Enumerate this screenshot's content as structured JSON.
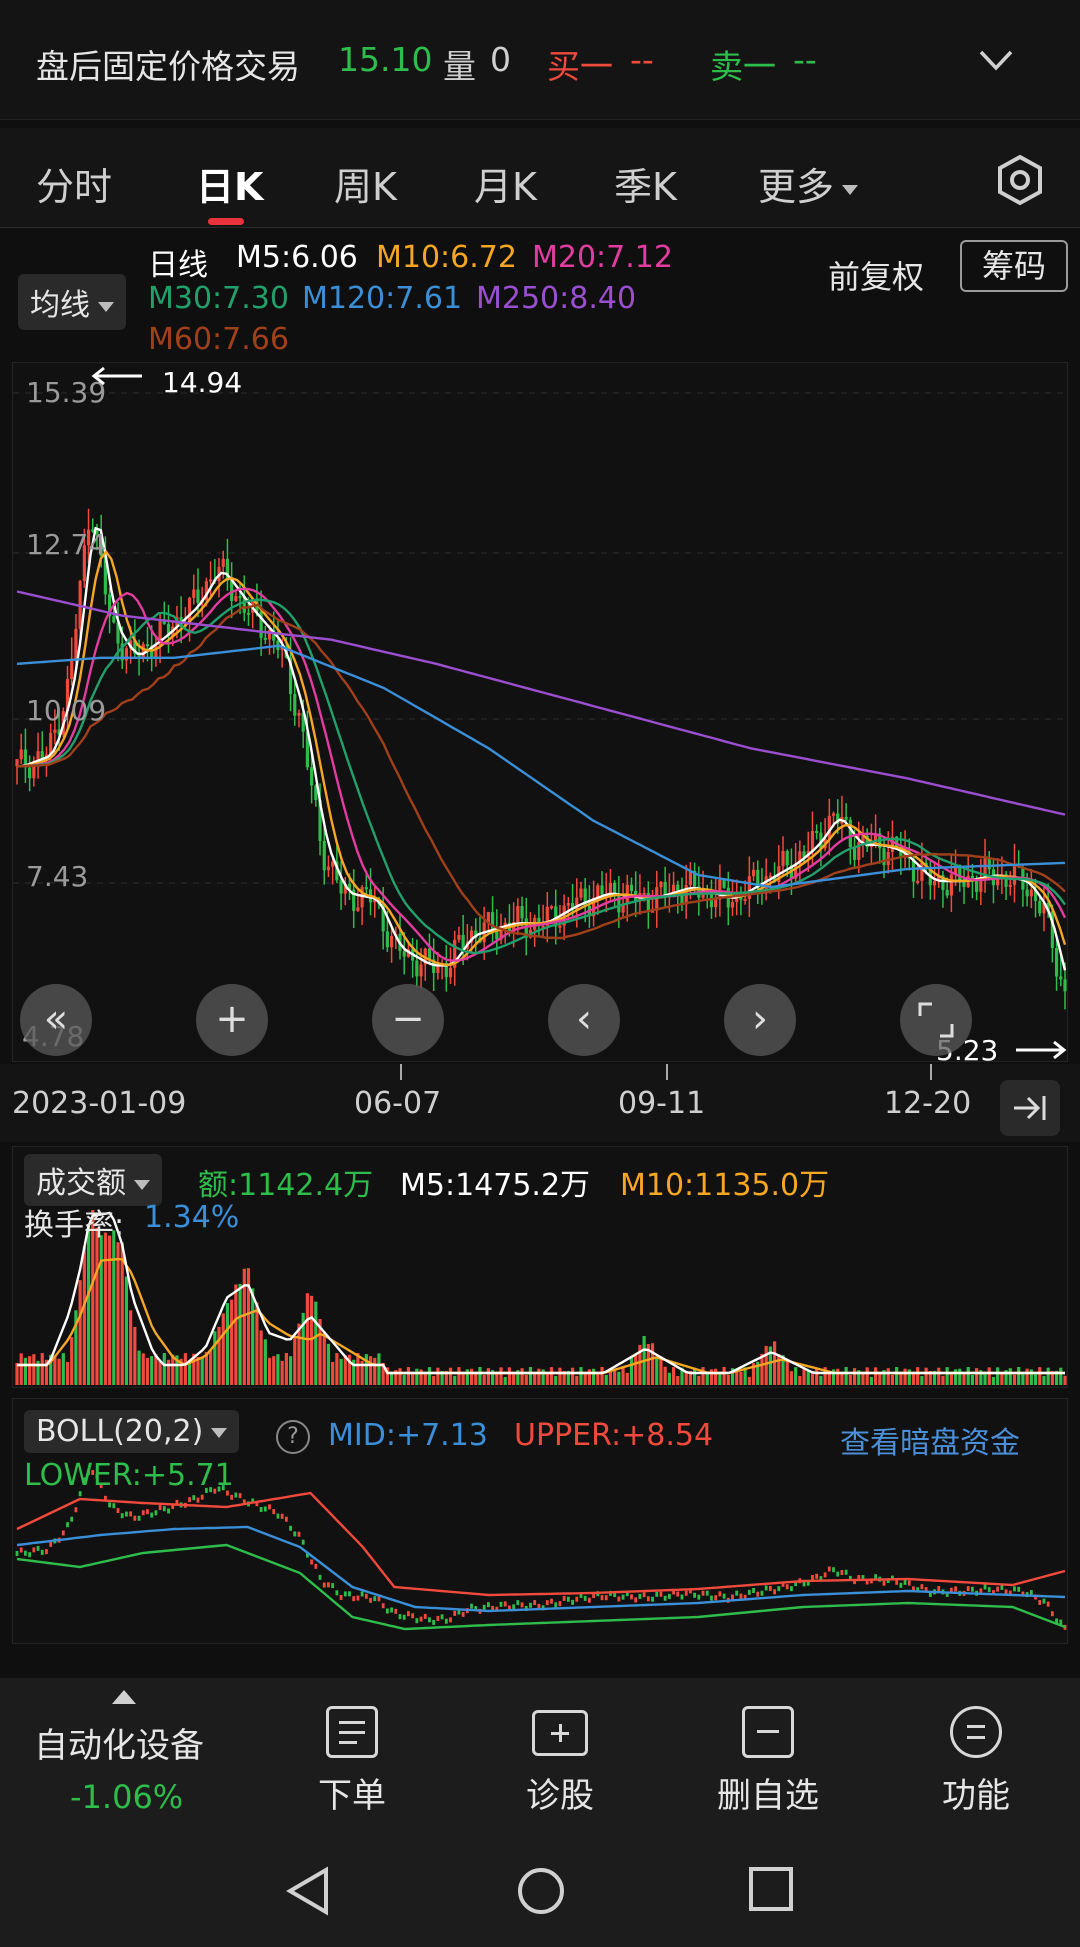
{
  "after_hours": {
    "label": "盘后固定价格交易",
    "price": "15.10",
    "vol_label": "量",
    "vol_value": "0",
    "bid_label": "买一",
    "bid_value": "--",
    "ask_label": "卖一",
    "ask_value": "--"
  },
  "tabs": [
    {
      "label": "分时"
    },
    {
      "label": "日K"
    },
    {
      "label": "周K"
    },
    {
      "label": "月K"
    },
    {
      "label": "季K"
    },
    {
      "label": "更多"
    }
  ],
  "ma_legend": {
    "dropdown": "均线",
    "period": "日线",
    "m5": "M5:6.06",
    "m10": "M10:6.72",
    "m20": "M20:7.12",
    "m30": "M30:7.30",
    "m120": "M120:7.61",
    "m250": "M250:8.40",
    "m60": "M60:7.66",
    "adjust": "前复权",
    "chips": "筹码"
  },
  "colors": {
    "up": "#f04a3c",
    "down": "#2ebd4a",
    "m5": "#ffffff",
    "m10": "#f5a623",
    "m20": "#e33ca0",
    "m30": "#22a06b",
    "m60": "#a0401a",
    "m120": "#3a8fd8",
    "m250": "#9b4fd0"
  },
  "chart_data": {
    "type": "candlestick",
    "y_ticks": [
      "15.39",
      "12.74",
      "10.09",
      "7.43",
      "4.78"
    ],
    "ylim": [
      4.78,
      15.39
    ],
    "high_marker": "14.94",
    "low_marker": "5.23",
    "x_labels": [
      "2023-01-09",
      "06-07",
      "09-11",
      "12-20"
    ]
  },
  "nav_buttons": [
    "«",
    "+",
    "−",
    "‹",
    "›"
  ],
  "volume": {
    "dropdown": "成交额",
    "amount": "额:1142.4万",
    "m5": "M5:1475.2万",
    "m10": "M10:1135.0万",
    "turnover_label": "换手率:",
    "turnover_value": "1.34%"
  },
  "boll": {
    "dropdown": "BOLL(20,2)",
    "help": "?",
    "mid": "MID:+7.13",
    "upper": "UPPER:+8.54",
    "lower": "LOWER:+5.71",
    "link": "查看暗盘资金"
  },
  "stock": {
    "name": "自动化设备",
    "change": "-1.06%"
  },
  "toolbar": [
    {
      "label": "下单"
    },
    {
      "label": "诊股"
    },
    {
      "label": "删自选"
    },
    {
      "label": "功能"
    }
  ]
}
